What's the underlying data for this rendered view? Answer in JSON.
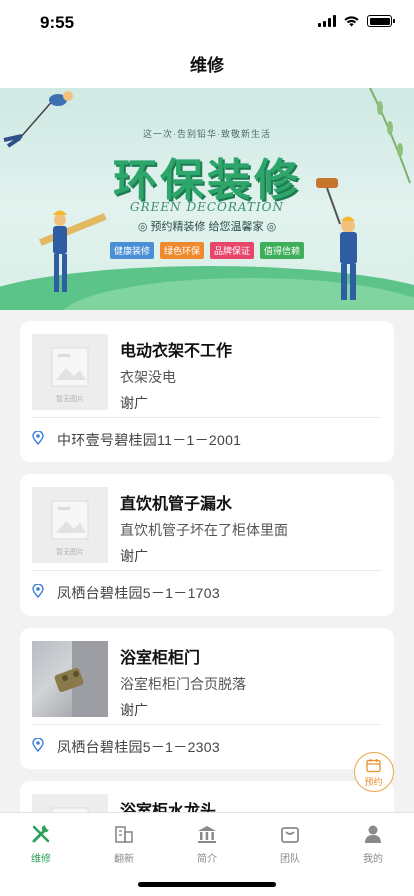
{
  "status": {
    "time": "9:55"
  },
  "nav": {
    "title": "维修"
  },
  "banner": {
    "subtitle": "这一次·告别铅华·致敬新生活",
    "title": "环保装修",
    "english": "GREEN DECORATION",
    "slogan": "◎ 预约精装修 给您温馨家 ◎",
    "tags": [
      {
        "label": "健康装修",
        "color": "#4a8fd6"
      },
      {
        "label": "绿色环保",
        "color": "#f08a2e"
      },
      {
        "label": "品牌保证",
        "color": "#e8456a"
      },
      {
        "label": "值得信赖",
        "color": "#3fae5a"
      }
    ]
  },
  "placeholder_text": "暂无图片",
  "orders": [
    {
      "title": "电动衣架不工作",
      "desc": "衣架没电",
      "user": "谢广",
      "address": "中环壹号碧桂园11－1－2001",
      "has_photo": false
    },
    {
      "title": "直饮机管子漏水",
      "desc": "直饮机管子坏在了柜体里面",
      "user": "谢广",
      "address": "凤栖台碧桂园5－1－1703",
      "has_photo": false
    },
    {
      "title": "浴室柜柜门",
      "desc": "浴室柜柜门合页脱落",
      "user": "谢广",
      "address": "凤栖台碧桂园5－1－2303",
      "has_photo": true
    },
    {
      "title": "浴室柜水龙头",
      "desc": "",
      "user": "",
      "address": "",
      "has_photo": false
    }
  ],
  "fab": {
    "label": "预约",
    "icon": "calendar-icon",
    "color": "#e8902c"
  },
  "tabs": [
    {
      "label": "维修",
      "icon": "wrench-icon",
      "active": true
    },
    {
      "label": "翻新",
      "icon": "building-icon",
      "active": false
    },
    {
      "label": "简介",
      "icon": "bank-icon",
      "active": false
    },
    {
      "label": "团队",
      "icon": "bag-icon",
      "active": false
    },
    {
      "label": "我的",
      "icon": "person-icon",
      "active": false
    }
  ],
  "colors": {
    "accent": "#2fa05b",
    "inactive": "#8a8a8a"
  }
}
